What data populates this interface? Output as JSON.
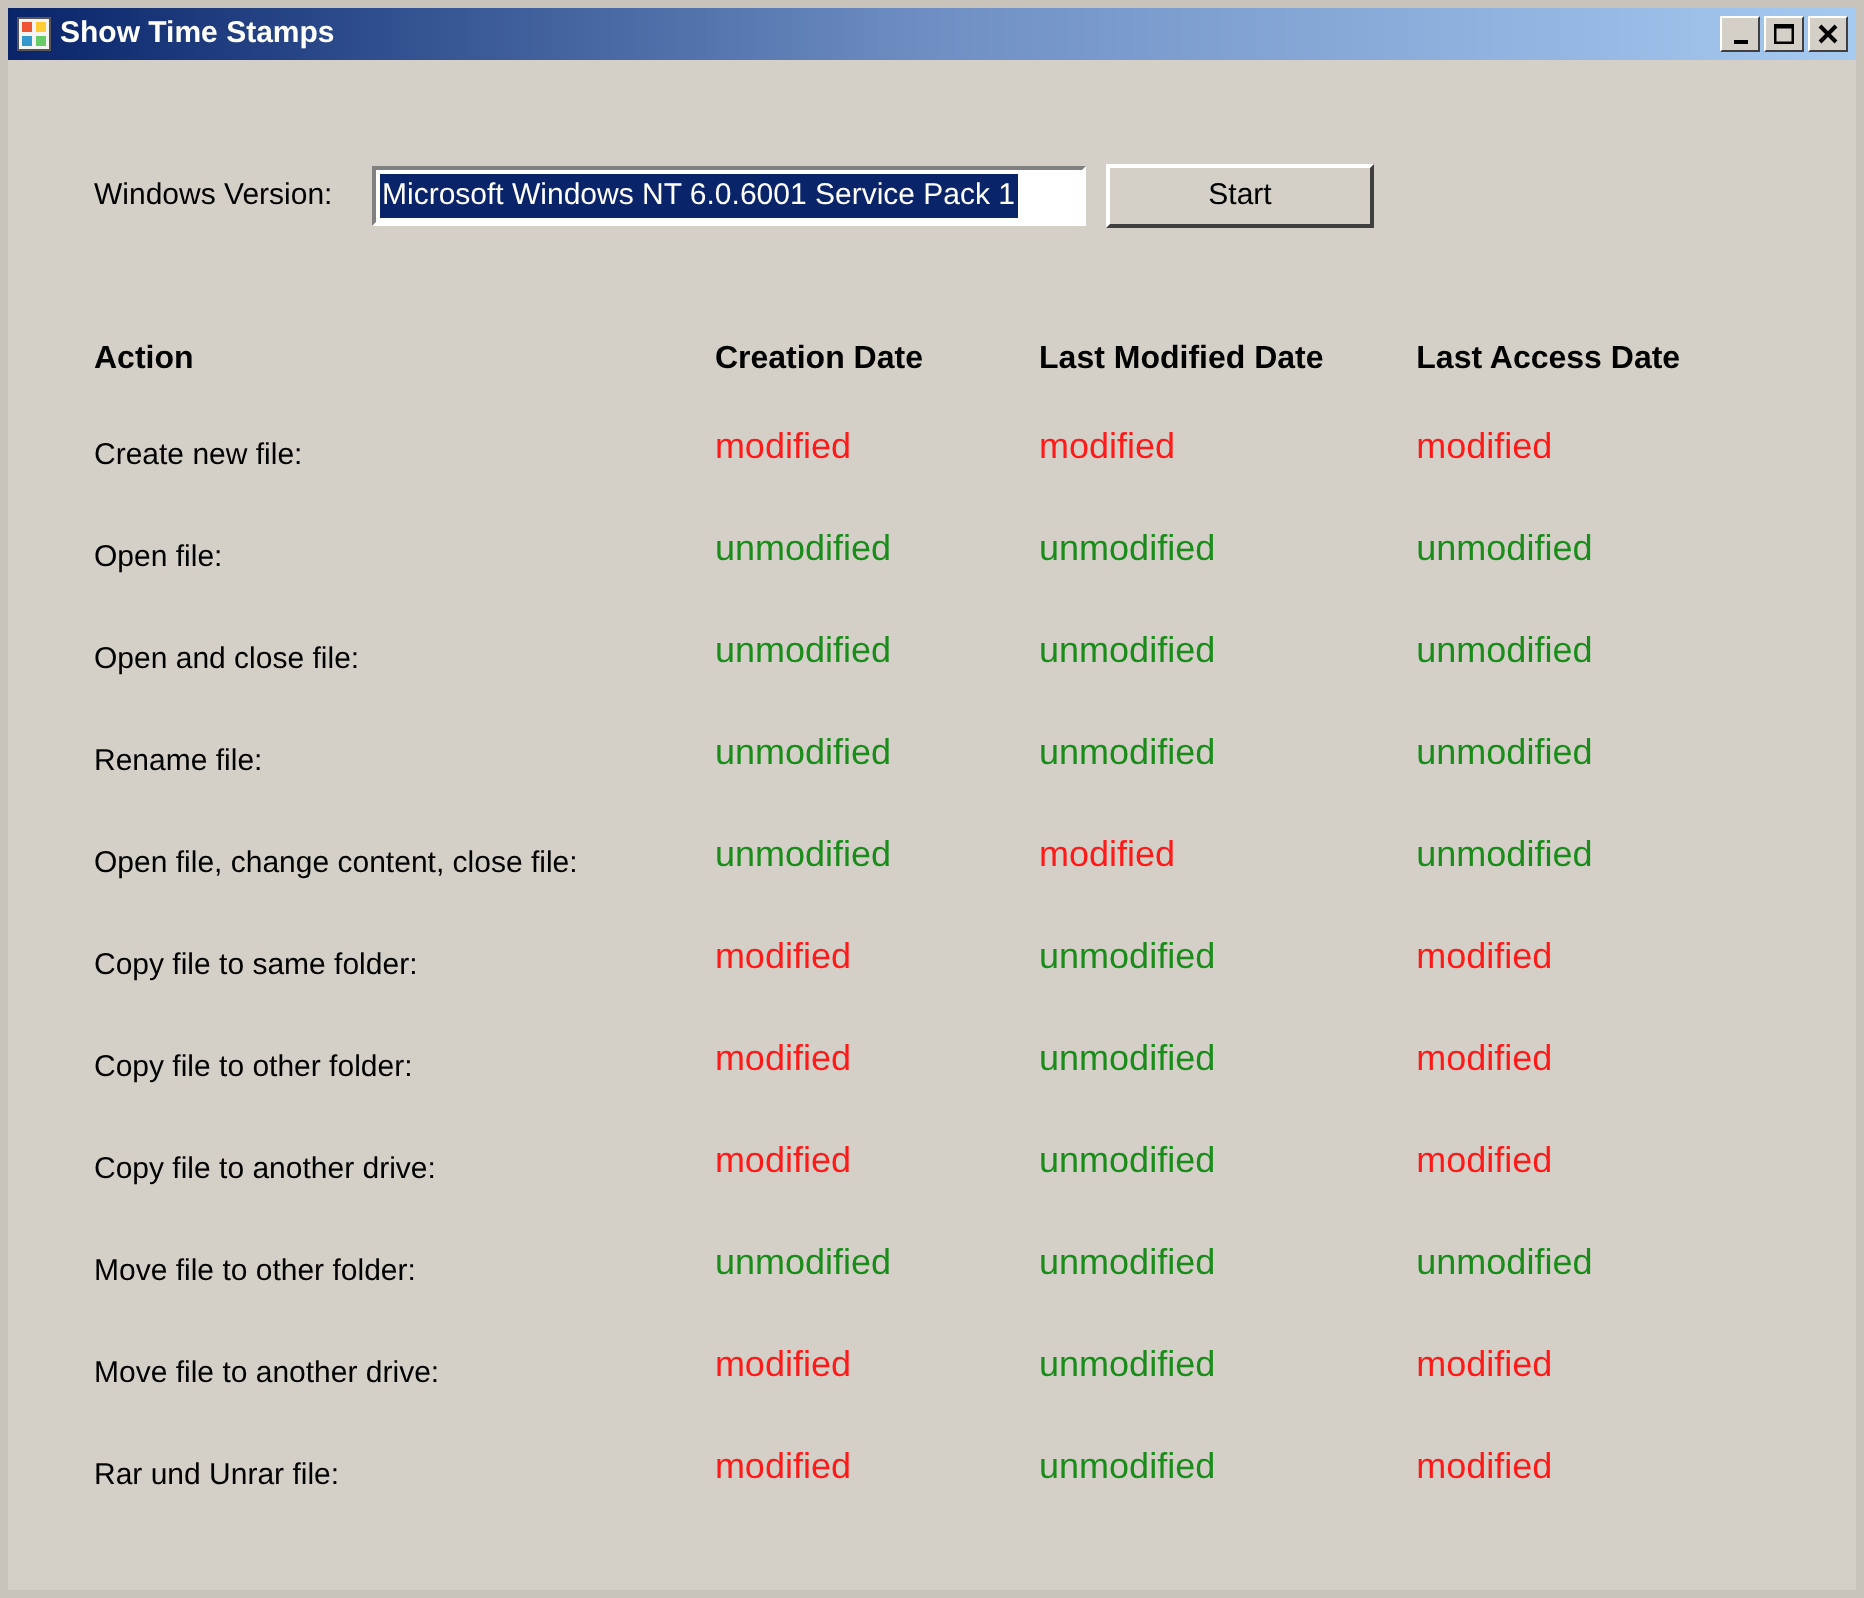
{
  "window": {
    "title": "Show Time Stamps"
  },
  "version_field": {
    "label": "Windows Version:",
    "value": "Microsoft Windows NT 6.0.6001 Service Pack 1",
    "selected": true
  },
  "start_button": {
    "label": "Start"
  },
  "table": {
    "columns": [
      "Action",
      "Creation Date",
      "Last Modified Date",
      "Last Access Date"
    ],
    "rows": [
      {
        "cells": [
          {
            "text": "Create new file:",
            "kind": "action"
          },
          {
            "text": "modified",
            "kind": "modified"
          },
          {
            "text": "modified",
            "kind": "modified"
          },
          {
            "text": "modified",
            "kind": "modified"
          }
        ]
      },
      {
        "cells": [
          {
            "text": "Open file:",
            "kind": "action"
          },
          {
            "text": "unmodified",
            "kind": "unmodified"
          },
          {
            "text": "unmodified",
            "kind": "unmodified"
          },
          {
            "text": "unmodified",
            "kind": "unmodified"
          }
        ]
      },
      {
        "cells": [
          {
            "text": "Open and close file:",
            "kind": "action"
          },
          {
            "text": "unmodified",
            "kind": "unmodified"
          },
          {
            "text": "unmodified",
            "kind": "unmodified"
          },
          {
            "text": "unmodified",
            "kind": "unmodified"
          }
        ]
      },
      {
        "cells": [
          {
            "text": "Rename file:",
            "kind": "action"
          },
          {
            "text": "unmodified",
            "kind": "unmodified"
          },
          {
            "text": "unmodified",
            "kind": "unmodified"
          },
          {
            "text": "unmodified",
            "kind": "unmodified"
          }
        ]
      },
      {
        "cells": [
          {
            "text": "Open file, change content, close file:",
            "kind": "action"
          },
          {
            "text": "unmodified",
            "kind": "unmodified"
          },
          {
            "text": "modified",
            "kind": "modified"
          },
          {
            "text": "unmodified",
            "kind": "unmodified"
          }
        ]
      },
      {
        "cells": [
          {
            "text": "Copy file to same folder:",
            "kind": "action"
          },
          {
            "text": "modified",
            "kind": "modified"
          },
          {
            "text": "unmodified",
            "kind": "unmodified"
          },
          {
            "text": "modified",
            "kind": "modified"
          }
        ]
      },
      {
        "cells": [
          {
            "text": "Copy file to other folder:",
            "kind": "action"
          },
          {
            "text": "modified",
            "kind": "modified"
          },
          {
            "text": "unmodified",
            "kind": "unmodified"
          },
          {
            "text": "modified",
            "kind": "modified"
          }
        ]
      },
      {
        "cells": [
          {
            "text": "Copy file to another drive:",
            "kind": "action"
          },
          {
            "text": "modified",
            "kind": "modified"
          },
          {
            "text": "unmodified",
            "kind": "unmodified"
          },
          {
            "text": "modified",
            "kind": "modified"
          }
        ]
      },
      {
        "cells": [
          {
            "text": "Move file to other folder:",
            "kind": "action"
          },
          {
            "text": "unmodified",
            "kind": "unmodified"
          },
          {
            "text": "unmodified",
            "kind": "unmodified"
          },
          {
            "text": "unmodified",
            "kind": "unmodified"
          }
        ]
      },
      {
        "cells": [
          {
            "text": "Move file to another drive:",
            "kind": "action"
          },
          {
            "text": "modified",
            "kind": "modified"
          },
          {
            "text": "unmodified",
            "kind": "unmodified"
          },
          {
            "text": "modified",
            "kind": "modified"
          }
        ]
      },
      {
        "cells": [
          {
            "text": "Rar und Unrar file:",
            "kind": "action"
          },
          {
            "text": "modified",
            "kind": "modified"
          },
          {
            "text": "unmodified",
            "kind": "unmodified"
          },
          {
            "text": "modified",
            "kind": "modified"
          }
        ]
      }
    ]
  }
}
